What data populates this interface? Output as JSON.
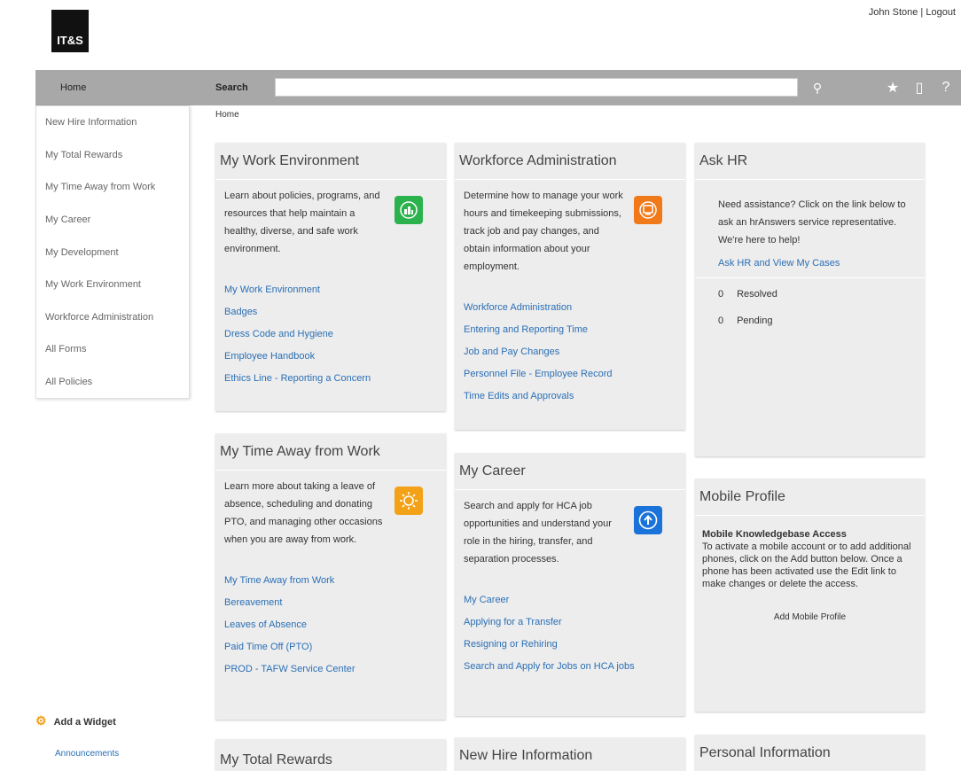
{
  "header": {
    "logo_text": "IT&S",
    "user_name": "John Stone",
    "separator": "|",
    "logout_label": "Logout"
  },
  "navbar": {
    "home_label": "Home",
    "search_label": "Search",
    "search_value": ""
  },
  "left_menu": {
    "items": [
      {
        "label": "New Hire Information"
      },
      {
        "label": "My Total Rewards"
      },
      {
        "label": "My Time Away from Work"
      },
      {
        "label": "My Career"
      },
      {
        "label": "My Development"
      },
      {
        "label": "My Work Environment"
      },
      {
        "label": "Workforce Administration"
      },
      {
        "label": "All Forms"
      },
      {
        "label": "All Policies"
      }
    ]
  },
  "breadcrumb": "Home",
  "widgets": {
    "work_env": {
      "title": "My Work Environment",
      "desc": "Learn about policies, programs, and resources that help maintain a healthy, diverse, and safe work environment.",
      "icon": "building-icon",
      "icon_color": "#2bb24c",
      "links": [
        "My Work Environment",
        "Badges",
        "Dress Code and Hygiene",
        "Employee Handbook",
        "Ethics Line - Reporting a Concern"
      ]
    },
    "workforce": {
      "title": "Workforce Administration",
      "desc": "Determine how to manage your work hours and timekeeping submissions, track job and pay changes, and obtain information about your employment.",
      "icon": "computer-icon",
      "icon_color": "#f07a1a",
      "links": [
        "Workforce Administration",
        "Entering and Reporting Time",
        "Job and Pay Changes",
        "Personnel File - Employee Record",
        "Time Edits and Approvals"
      ]
    },
    "ask_hr": {
      "title": "Ask HR",
      "desc": "Need assistance? Click on the link below to ask an hrAnswers service representative. We're here to help!",
      "link": "Ask HR and View My Cases",
      "stats": [
        {
          "count": "0",
          "label": "Resolved"
        },
        {
          "count": "0",
          "label": "Pending"
        }
      ]
    },
    "time_away": {
      "title": "My Time Away from Work",
      "desc": "Learn more about taking a leave of absence, scheduling and donating PTO, and managing other occasions when you are away from work.",
      "icon": "sun-icon",
      "icon_color": "#f3a116",
      "links": [
        "My Time Away from Work",
        "Bereavement",
        "Leaves of Absence",
        "Paid Time Off (PTO)",
        "PROD - TAFW Service Center"
      ]
    },
    "career": {
      "title": "My Career",
      "desc": "Search and apply for HCA job opportunities and understand your role in the hiring, transfer, and separation processes.",
      "icon": "arrow-up-icon",
      "icon_color": "#1a73d9",
      "links": [
        "My Career",
        "Applying for a Transfer",
        "Resigning or Rehiring",
        "Search and Apply for Jobs on HCA jobs"
      ]
    },
    "mobile": {
      "title": "Mobile Profile",
      "heading": "Mobile Knowledgebase Access",
      "desc": "To activate a mobile account or to add additional phones, click on the Add button below. Once a phone has been activated use the Edit link to make changes or delete the access.",
      "add_label": "Add Mobile Profile"
    },
    "total_rewards": {
      "title": "My Total Rewards"
    },
    "new_hire": {
      "title": "New Hire Information"
    },
    "personal": {
      "title": "Personal Information"
    }
  },
  "add_widget": {
    "label": "Add a Widget",
    "item": "Announcements"
  }
}
